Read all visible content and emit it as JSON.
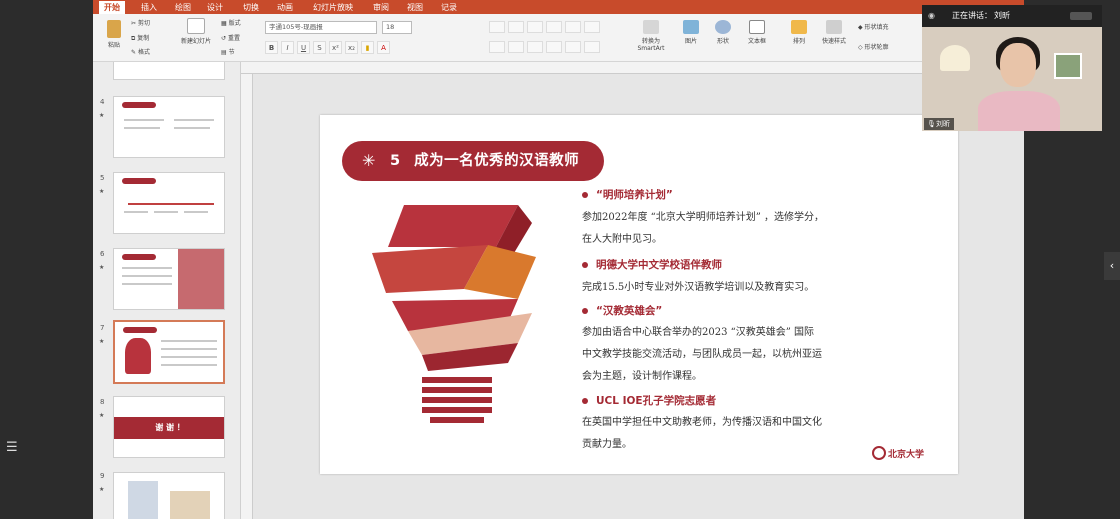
{
  "ribbon": {
    "tabs": [
      "开始",
      "插入",
      "绘图",
      "设计",
      "切换",
      "动画",
      "幻灯片放映",
      "审阅",
      "视图",
      "记录"
    ],
    "active_tab": "开始",
    "paste_label": "粘贴",
    "cut_label": "剪切",
    "copy_label": "复制",
    "format_label": "格式",
    "new_slide_label": "新建幻灯片",
    "layout_label": "版式",
    "reset_label": "重置",
    "section_label": "节",
    "font_name": "字通105号-现画报",
    "font_size": "18",
    "smartart_label": "转换为SmartArt",
    "picture_label": "图片",
    "shape_label": "形状",
    "textbox_label": "文本框",
    "arrange_label": "排列",
    "quickstyle_label": "快速样式",
    "shapefill_label": "形状填充",
    "shapeoutline_label": "形状轮廓"
  },
  "thumbnails": [
    {
      "num": "4"
    },
    {
      "num": "5"
    },
    {
      "num": "6"
    },
    {
      "num": "7",
      "selected": true
    },
    {
      "num": "8",
      "text": "谢 谢 ！"
    },
    {
      "num": "9"
    }
  ],
  "slide": {
    "title_number": "5",
    "title": "成为一名优秀的汉语教师",
    "items": [
      {
        "heading": "“明师培养计划”",
        "text": [
          "参加2022年度 “北京大学明师培养计划” ，选修学分，",
          "在人大附中见习。"
        ]
      },
      {
        "heading": "明德大学中文学校语伴教师",
        "text": [
          "完成15.5小时专业对外汉语教学培训以及教育实习。"
        ]
      },
      {
        "heading": "“汉教英雄会”",
        "text": [
          "参加由语合中心联合举办的2023 “汉教英雄会” 国际",
          "中文教学技能交流活动，与团队成员一起，以杭州亚运",
          "会为主题，设计制作课程。"
        ]
      },
      {
        "heading": "UCL IOE孔子学院志愿者",
        "text": [
          "在英国中学担任中文助教老师，为传播汉语和中国文化",
          "贡献力量。"
        ]
      }
    ],
    "logo_text": "北京大学"
  },
  "video": {
    "speaking_label": "正在讲话：",
    "speaker_name": "刘昕",
    "name_tag": "刘昕"
  },
  "colors": {
    "accent": "#a42a34",
    "ribbon": "#c84b2b"
  }
}
